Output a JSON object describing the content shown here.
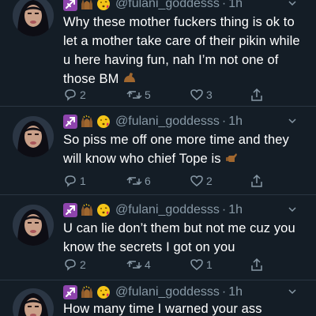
{
  "tweets": [
    {
      "handle": "@fulani_goddesss",
      "time": "1h",
      "text": "Why these mother fuckers thing is ok to let a mother take care of their pikin while u here having fun, nah I’m not one of those BM",
      "trailing_emoji": "flexed-biceps",
      "replies": "2",
      "retweets": "5",
      "likes": "3"
    },
    {
      "handle": "@fulani_goddesss",
      "time": "1h",
      "text": "So piss me off one more time and they will know who chief Tope is",
      "trailing_emoji": "call-me-hand",
      "replies": "1",
      "retweets": "6",
      "likes": "2"
    },
    {
      "handle": "@fulani_goddesss",
      "time": "1h",
      "text": "U can lie don’t them but not me cuz you know the secrets I got on you",
      "trailing_emoji": "",
      "replies": "2",
      "retweets": "4",
      "likes": "1"
    },
    {
      "handle": "@fulani_goddesss",
      "time": "1h",
      "text": "How many time I warned your ass",
      "trailing_emoji": "",
      "replies": "",
      "retweets": "",
      "likes": ""
    }
  ],
  "header_emojis": [
    "sagittarius-icon",
    "raising-hands-icon",
    "face-blowing-kiss-icon"
  ],
  "colors": {
    "background": "#141d26",
    "secondary_text": "#8899a6",
    "primary_text": "#ffffff",
    "divider": "#2a3642",
    "sagittarius": "#8e44ad"
  }
}
